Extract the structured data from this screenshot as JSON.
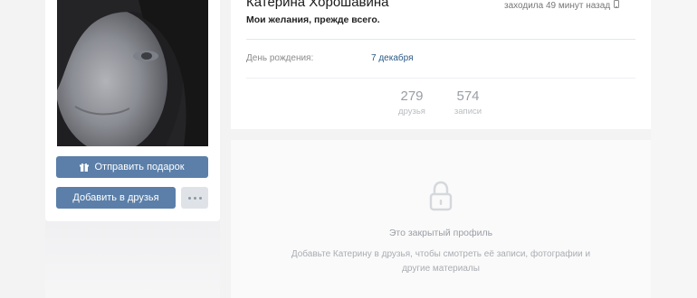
{
  "profile": {
    "name": "Катерина Хорошавина",
    "status": "Мои желания, прежде всего.",
    "last_seen": "заходила 49 минут назад"
  },
  "info": {
    "birthday_label": "День рождения:",
    "birthday_value": "7 декабря"
  },
  "counters": [
    {
      "value": "279",
      "label": "друзья"
    },
    {
      "value": "574",
      "label": "записи"
    }
  ],
  "actions": {
    "gift_label": "Отправить подарок",
    "add_friend_label": "Добавить в друзья"
  },
  "closed_profile": {
    "title": "Это закрытый профиль",
    "description": "Добавьте Катерину в друзья, чтобы смотреть её записи, фотографии и другие материалы"
  },
  "colors": {
    "button": "#5b7fa9",
    "link": "#2a5885",
    "background": "#f3f3f4"
  },
  "icons": [
    "gift-icon",
    "mobile-phone-icon",
    "more-dots-icon",
    "lock-icon"
  ]
}
